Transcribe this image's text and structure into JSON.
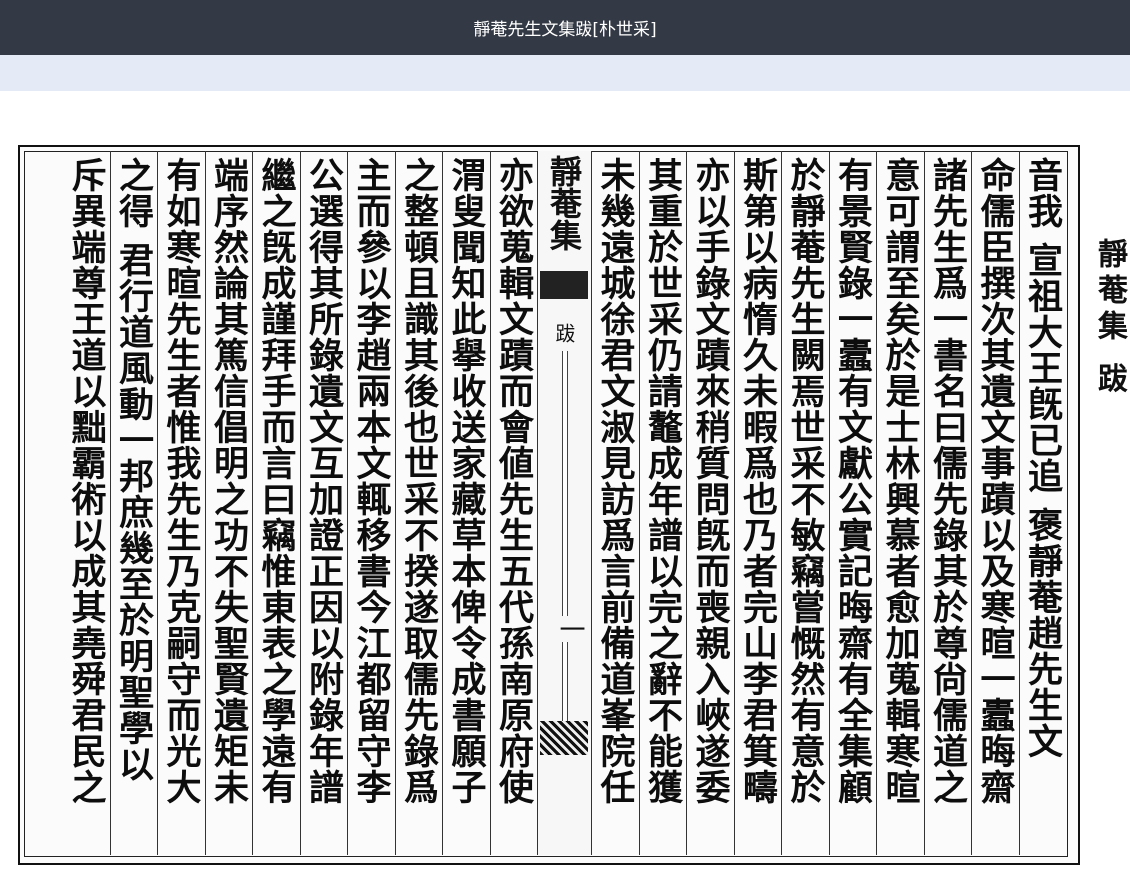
{
  "window": {
    "title": "靜菴先生文集跋[朴世采]"
  },
  "document": {
    "fold_title": "靜菴集",
    "fold_chapter": "跋",
    "fold_page": "一",
    "margin_label": "靜菴集 跋",
    "columns": [
      "音我 宣祖大王旣已追 褒靜菴趙先生文",
      "命儒臣撰次其遺文事蹟以及寒暄一蠹晦齋",
      "諸先生爲一書名曰儒先錄其於尊尙儒道之",
      "意可謂至矣於是士林興慕者愈加蒐輯寒暄",
      "有景賢錄一蠹有文獻公實記晦齋有全集顧",
      "於靜菴先生闕焉世采不敏竊嘗慨然有意於",
      "斯第以病惰久未暇爲也乃者完山李君箕疇",
      "亦以手錄文蹟來稍質問旣而喪親入峽遂委",
      "其重於世采仍請鼇成年譜以完之辭不能獲",
      "未幾遠城徐君文淑見訪爲言前備道峯院任",
      "亦欲蒐輯文蹟而會値先生五代孫南原府使",
      "渭叟聞知此擧收送家藏草本俾令成書願子",
      "之整頓且識其後也世采不揆遂取儒先錄爲",
      "主而參以李趙兩本文輒移書今江都留守李",
      "公選得其所錄遺文互加證正因以附錄年譜",
      "繼之旣成謹拜手而言曰竊惟東表之學遠有",
      "端序然論其篤信倡明之功不失聖賢遺矩未",
      "有如寒暄先生者惟我先生乃克嗣守而光大",
      "之得 君行道風動一邦庶幾至於明聖學以",
      "斥異端尊王道以黜霸術以成其堯舜君民之"
    ]
  }
}
